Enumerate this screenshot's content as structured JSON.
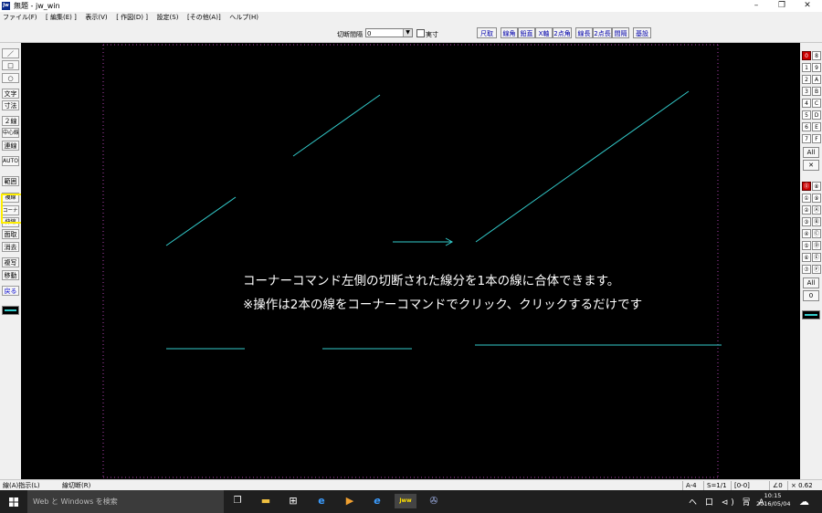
{
  "window": {
    "title": "無題 - jw_win",
    "app_icon_text": "Jw",
    "controls": [
      "–",
      "❐",
      "✕"
    ]
  },
  "menu": [
    "ファイル(F)",
    "[ 編集(E) ]",
    "表示(V)",
    "[ 作図(D) ]",
    "設定(S)",
    "[その他(A)]",
    "ヘルプ(H)"
  ],
  "toolbar": {
    "cut_interval_label": "切断間隔",
    "cut_interval_value": "0",
    "real_size_label": "実寸",
    "real_size_checked": false,
    "buttons": [
      "尺取",
      "線角",
      "鉛直",
      "X軸",
      "2点角",
      "線長",
      "2点長",
      "間隔",
      "基設"
    ]
  },
  "left_tools": [
    "／",
    "□",
    "○",
    "文字",
    "寸法",
    "２線",
    "中心線",
    "連線",
    "AUTO",
    "範囲",
    "複線",
    "コーナー",
    "伸縮",
    "面取",
    "消去",
    "複写",
    "移動",
    "戻る"
  ],
  "canvas": {
    "caption_line1": "コーナーコマンド左側の切断された線分を1本の線に合体できます。",
    "caption_line2": "※操作は2本の線をコーナーコマンドでクリック、クリックするだけです",
    "line_color": "#33cccc",
    "guide_color": "#cc44cc"
  },
  "right_panel": {
    "layer_groups": [
      "0",
      "1",
      "2",
      "3",
      "4",
      "5",
      "6",
      "7",
      "8",
      "9",
      "A",
      "B",
      "C",
      "D",
      "E",
      "F"
    ],
    "layers_circled": [
      "⓪",
      "①",
      "②",
      "③",
      "④",
      "⑤",
      "⑥",
      "⑦",
      "⑧",
      "⑨",
      "Ⓐ",
      "Ⓑ",
      "Ⓒ",
      "Ⓓ",
      "Ⓔ",
      "Ⓕ"
    ],
    "all_label": "All",
    "cross_label": "✕",
    "zero_label": "0",
    "active_color": "#cc0000"
  },
  "status": {
    "left_text": "線(A)指示(L)",
    "mode_text": "線切断(R)",
    "paper": "A-4",
    "scale": "S=1/1",
    "layer": "[0-0]",
    "angle": "∠0",
    "zoom": "× 0.62"
  },
  "taskbar": {
    "search_placeholder": "Web と Windows を検索",
    "tray": "ヘ 口 ⊲) 冐 A",
    "time": "10:15",
    "date": "2016/05/04"
  }
}
